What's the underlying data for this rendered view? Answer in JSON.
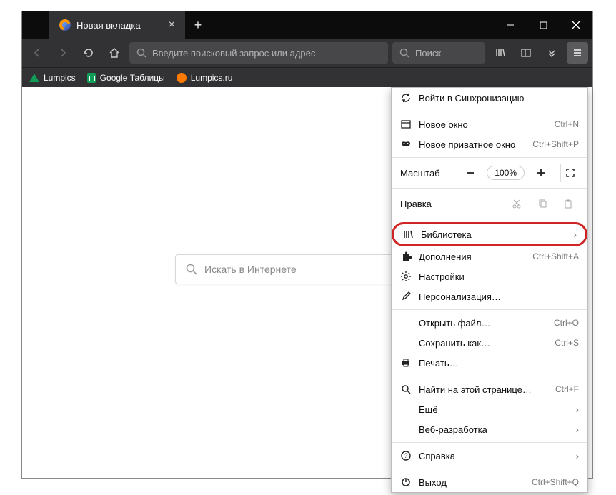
{
  "tab": {
    "title": "Новая вкладка"
  },
  "urlbar": {
    "placeholder": "Введите поисковый запрос или адрес"
  },
  "searchbar": {
    "placeholder": "Поиск"
  },
  "bookmarks": [
    {
      "label": "Lumpics"
    },
    {
      "label": "Google Таблицы"
    },
    {
      "label": "Lumpics.ru"
    }
  ],
  "homesearch": {
    "placeholder": "Искать в Интернете"
  },
  "menu": {
    "sync": "Войти в Синхронизацию",
    "newwindow": {
      "label": "Новое окно",
      "shortcut": "Ctrl+N"
    },
    "newprivate": {
      "label": "Новое приватное окно",
      "shortcut": "Ctrl+Shift+P"
    },
    "zoom": {
      "label": "Масштаб",
      "value": "100%"
    },
    "edit": {
      "label": "Правка"
    },
    "library": "Библиотека",
    "addons": {
      "label": "Дополнения",
      "shortcut": "Ctrl+Shift+A"
    },
    "settings": "Настройки",
    "customize": "Персонализация…",
    "openfile": {
      "label": "Открыть файл…",
      "shortcut": "Ctrl+O"
    },
    "saveas": {
      "label": "Сохранить как…",
      "shortcut": "Ctrl+S"
    },
    "print": "Печать…",
    "find": {
      "label": "Найти на этой странице…",
      "shortcut": "Ctrl+F"
    },
    "more": "Ещё",
    "webdev": "Веб-разработка",
    "help": "Справка",
    "exit": {
      "label": "Выход",
      "shortcut": "Ctrl+Shift+Q"
    }
  }
}
